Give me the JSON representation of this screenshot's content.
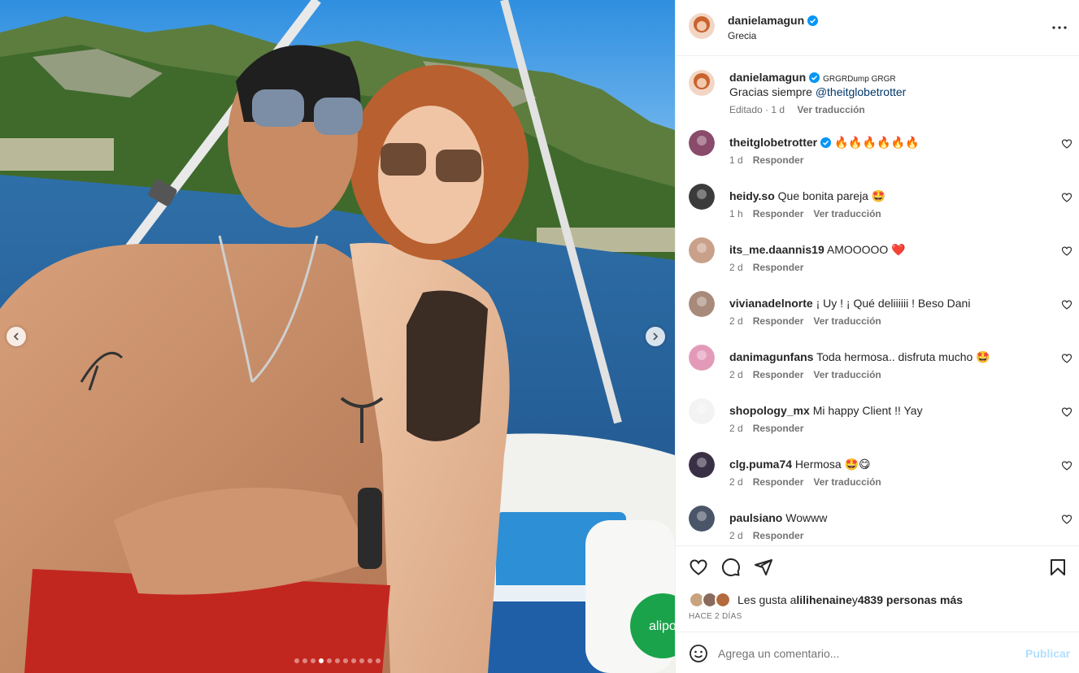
{
  "post": {
    "author": "danielamagun",
    "location": "Grecia",
    "caption": {
      "username": "danielamagun",
      "tag": "GRGRDump GRGR",
      "text": "Gracias siempre ",
      "mention": "@theitglobetrotter",
      "edited": "Editado · 1 d",
      "translate": "Ver traducción"
    },
    "carousel": {
      "count": 11,
      "active_index": 3
    }
  },
  "comments": [
    {
      "username": "theitglobetrotter",
      "verified": true,
      "text": "🔥🔥🔥🔥🔥🔥",
      "time": "1 d",
      "reply": "Responder",
      "translate": ""
    },
    {
      "username": "heidy.so",
      "verified": false,
      "text": "Que bonita pareja 🤩",
      "time": "1 h",
      "reply": "Responder",
      "translate": "Ver traducción"
    },
    {
      "username": "its_me.daannis19",
      "verified": false,
      "text": "AMOOOOO ❤️",
      "time": "2 d",
      "reply": "Responder",
      "translate": ""
    },
    {
      "username": "vivianadelnorte",
      "verified": false,
      "text": "¡ Uy ! ¡ Qué deliiiiii ! Beso Dani",
      "time": "2 d",
      "reply": "Responder",
      "translate": "Ver traducción"
    },
    {
      "username": "danimagunfans",
      "verified": false,
      "text": "Toda hermosa.. disfruta mucho 🤩",
      "time": "2 d",
      "reply": "Responder",
      "translate": "Ver traducción"
    },
    {
      "username": "shopology_mx",
      "verified": false,
      "text": "Mi happy Client !! Yay",
      "time": "2 d",
      "reply": "Responder",
      "translate": ""
    },
    {
      "username": "clg.puma74",
      "verified": false,
      "text": "Hermosa 🤩😋",
      "time": "2 d",
      "reply": "Responder",
      "translate": "Ver traducción"
    },
    {
      "username": "paulsiano",
      "verified": false,
      "text": "Wowww",
      "time": "2 d",
      "reply": "Responder",
      "translate": ""
    }
  ],
  "likes": {
    "prefix": "Les gusta a ",
    "user": "lilihenaine",
    "middle": " y ",
    "others": "4839 personas más"
  },
  "date": "HACE 2 DÍAS",
  "add_comment": {
    "placeholder": "Agrega un comentario...",
    "publish": "Publicar"
  },
  "photo_text": {
    "cooler_brand": "alipo"
  },
  "colors": {
    "verified": "#0095f6",
    "link": "#00376b",
    "muted": "#737373",
    "publish_disabled": "#b2dffc"
  }
}
